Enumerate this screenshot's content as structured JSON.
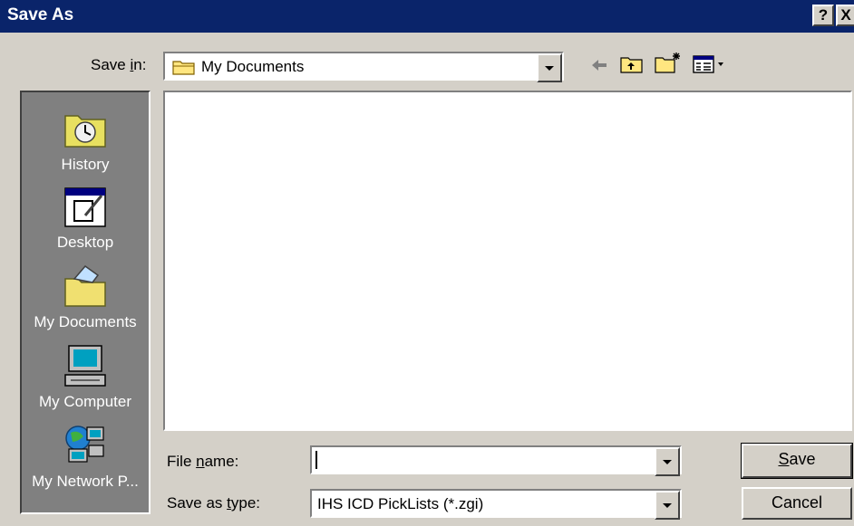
{
  "window": {
    "title": "Save As",
    "help_label": "?",
    "close_label": "X"
  },
  "save_in": {
    "label_pre": "Save ",
    "label_key": "i",
    "label_post": "n:",
    "value": "My Documents"
  },
  "places": [
    {
      "label": "History",
      "icon": "history-icon"
    },
    {
      "label": "Desktop",
      "icon": "desktop-icon"
    },
    {
      "label": "My Documents",
      "icon": "my-documents-icon"
    },
    {
      "label": "My Computer",
      "icon": "my-computer-icon"
    },
    {
      "label": "My Network P...",
      "icon": "my-network-places-icon"
    }
  ],
  "file_name": {
    "label_pre": "File ",
    "label_key": "n",
    "label_post": "ame:",
    "value": ""
  },
  "save_as_type": {
    "label_pre": "Save as ",
    "label_key": "t",
    "label_post": "ype:",
    "value": "IHS ICD PickLists (*.zgi)"
  },
  "buttons": {
    "save_key": "S",
    "save_rest": "ave",
    "cancel": "Cancel"
  },
  "colors": {
    "titlebar": "#0a246a",
    "face": "#d4d0c8",
    "places_bg": "#808080"
  }
}
